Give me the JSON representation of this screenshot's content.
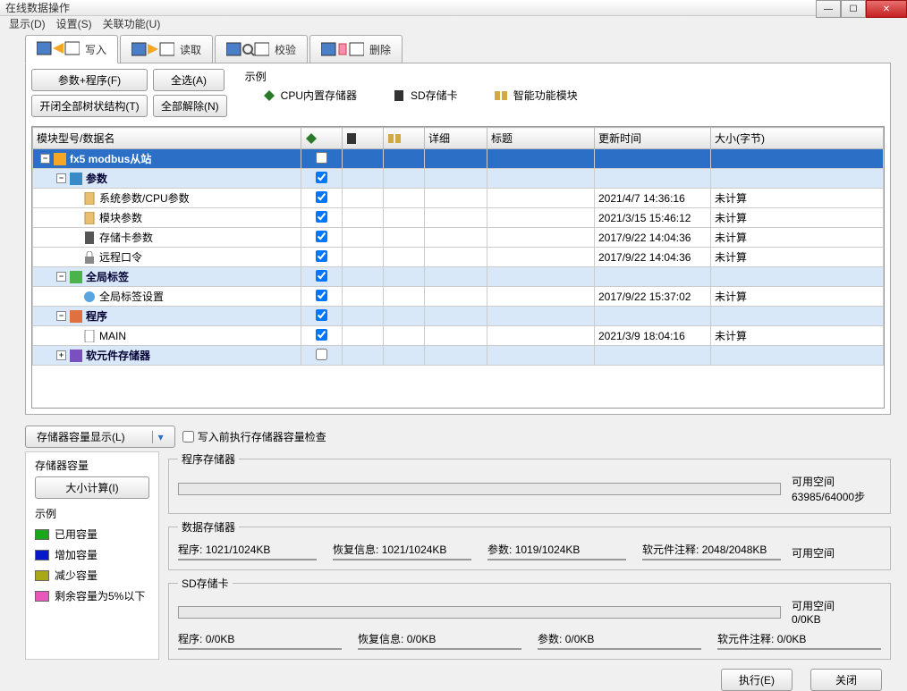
{
  "window": {
    "title": "在线数据操作"
  },
  "menu": {
    "display": "显示(D)",
    "settings": "设置(S)",
    "related": "关联功能(U)"
  },
  "tabs": {
    "write": "写入",
    "read": "读取",
    "verify": "校验",
    "delete": "删除"
  },
  "toolbar": {
    "param_program": "参数+程序(F)",
    "select_all": "全选(A)",
    "open_close_tree": "开闭全部树状结构(T)",
    "deselect_all": "全部解除(N)"
  },
  "legend": {
    "title": "示例",
    "builtin": "CPU内置存储器",
    "sdcard": "SD存储卡",
    "smart_module": "智能功能模块"
  },
  "columns": {
    "name": "模块型号/数据名",
    "detail": "详细",
    "title_h": "标题",
    "updated": "更新时间",
    "size": "大小(字节)"
  },
  "untcalc": "未计算",
  "rows": {
    "root": "fx5 modbus从站",
    "params": "参数",
    "sys_params": "系统参数/CPU参数",
    "mod_params": "模块参数",
    "sd_params": "存储卡参数",
    "remote": "远程口令",
    "global_label": "全局标签",
    "global_label_set": "全局标签设置",
    "program": "程序",
    "main": "MAIN",
    "device_mem": "软元件存储器",
    "times": {
      "sys": "2021/4/7 14:36:16",
      "mod": "2021/3/15 15:46:12",
      "sd": "2017/9/22 14:04:36",
      "remote": "2017/9/22 14:04:36",
      "glset": "2017/9/22 15:37:02",
      "main": "2021/3/9 18:04:16"
    }
  },
  "storage": {
    "show_btn": "存储器容量显示(L)",
    "pre_check": "写入前执行存储器容量检查",
    "capacity_header": "存储器容量",
    "calc_btn": "大小计算(I)",
    "legend_header": "示例",
    "used": "已用容量",
    "added": "增加容量",
    "reduced": "减少容量",
    "remain5": "剩余容量为5%以下",
    "prog_store": "程序存储器",
    "avail": "可用空间",
    "prog_avail": "63985/64000步",
    "data_store": "数据存储器",
    "prog": "程序:",
    "prog_v": "1021/1024KB",
    "restore": "恢复信息:",
    "restore_v": "1021/1024KB",
    "param": "参数:",
    "param_v": "1019/1024KB",
    "devcmt": "软元件注释:",
    "devcmt_v": "2048/2048KB",
    "sdcard": "SD存储卡",
    "sd_avail": "0/0KB",
    "prog_z": "0/0KB",
    "restore_z": "0/0KB",
    "param_z": "0/0KB",
    "devcmt_z": "0/0KB"
  },
  "buttons": {
    "execute": "执行(E)",
    "close": "关闭"
  }
}
